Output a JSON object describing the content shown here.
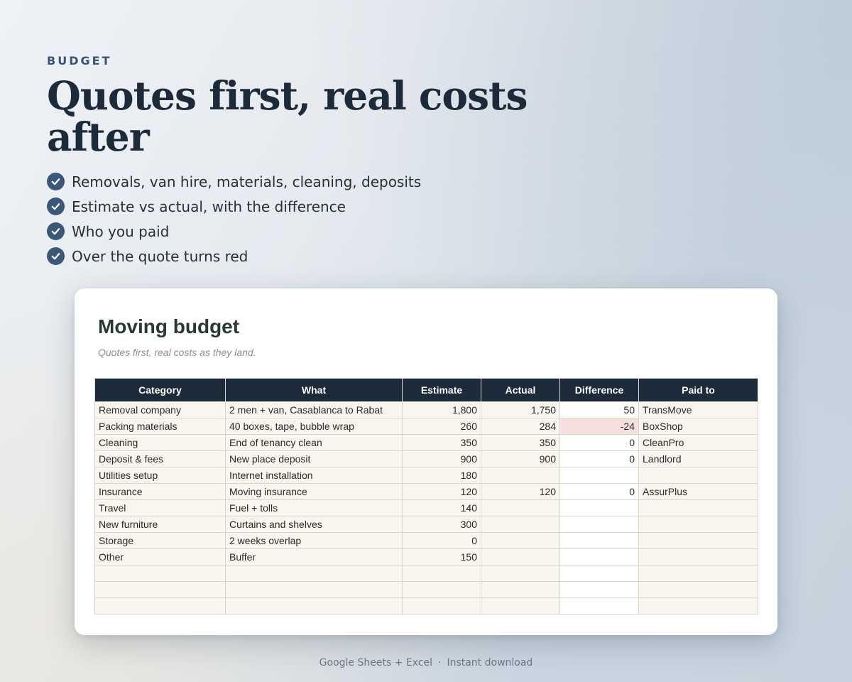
{
  "eyebrow": "BUDGET",
  "headline": "Quotes first, real costs after",
  "features": [
    "Removals, van hire, materials, cleaning, deposits",
    "Estimate vs actual, with the difference",
    "Who you paid",
    "Over the quote turns red"
  ],
  "sheet": {
    "title": "Moving budget",
    "subtitle": "Quotes first, real costs as they land.",
    "headers": [
      "Category",
      "What",
      "Estimate",
      "Actual",
      "Difference",
      "Paid to"
    ],
    "rows": [
      {
        "category": "Removal company",
        "what": "2 men + van, Casablanca to Rabat",
        "estimate": "1,800",
        "actual": "1,750",
        "difference": "50",
        "paid_to": "TransMove",
        "over": false
      },
      {
        "category": "Packing materials",
        "what": "40 boxes, tape, bubble wrap",
        "estimate": "260",
        "actual": "284",
        "difference": "-24",
        "paid_to": "BoxShop",
        "over": true
      },
      {
        "category": "Cleaning",
        "what": "End of tenancy clean",
        "estimate": "350",
        "actual": "350",
        "difference": "0",
        "paid_to": "CleanPro",
        "over": false
      },
      {
        "category": "Deposit & fees",
        "what": "New place deposit",
        "estimate": "900",
        "actual": "900",
        "difference": "0",
        "paid_to": "Landlord",
        "over": false
      },
      {
        "category": "Utilities setup",
        "what": "Internet installation",
        "estimate": "180",
        "actual": "",
        "difference": "",
        "paid_to": "",
        "over": false
      },
      {
        "category": "Insurance",
        "what": "Moving insurance",
        "estimate": "120",
        "actual": "120",
        "difference": "0",
        "paid_to": "AssurPlus",
        "over": false
      },
      {
        "category": "Travel",
        "what": "Fuel + tolls",
        "estimate": "140",
        "actual": "",
        "difference": "",
        "paid_to": "",
        "over": false
      },
      {
        "category": "New furniture",
        "what": "Curtains and shelves",
        "estimate": "300",
        "actual": "",
        "difference": "",
        "paid_to": "",
        "over": false
      },
      {
        "category": "Storage",
        "what": "2 weeks overlap",
        "estimate": "0",
        "actual": "",
        "difference": "",
        "paid_to": "",
        "over": false
      },
      {
        "category": "Other",
        "what": "Buffer",
        "estimate": "150",
        "actual": "",
        "difference": "",
        "paid_to": "",
        "over": false
      },
      {
        "category": "",
        "what": "",
        "estimate": "",
        "actual": "",
        "difference": "",
        "paid_to": "",
        "over": false
      },
      {
        "category": "",
        "what": "",
        "estimate": "",
        "actual": "",
        "difference": "",
        "paid_to": "",
        "over": false
      },
      {
        "category": "",
        "what": "",
        "estimate": "",
        "actual": "",
        "difference": "",
        "paid_to": "",
        "over": false
      }
    ]
  },
  "footer": {
    "left": "Google Sheets + Excel",
    "separator": "·",
    "right": "Instant download"
  },
  "colors": {
    "accent": "#3c5777",
    "header_bg": "#1d2a3a",
    "over_quote": "#f6dfdd"
  }
}
